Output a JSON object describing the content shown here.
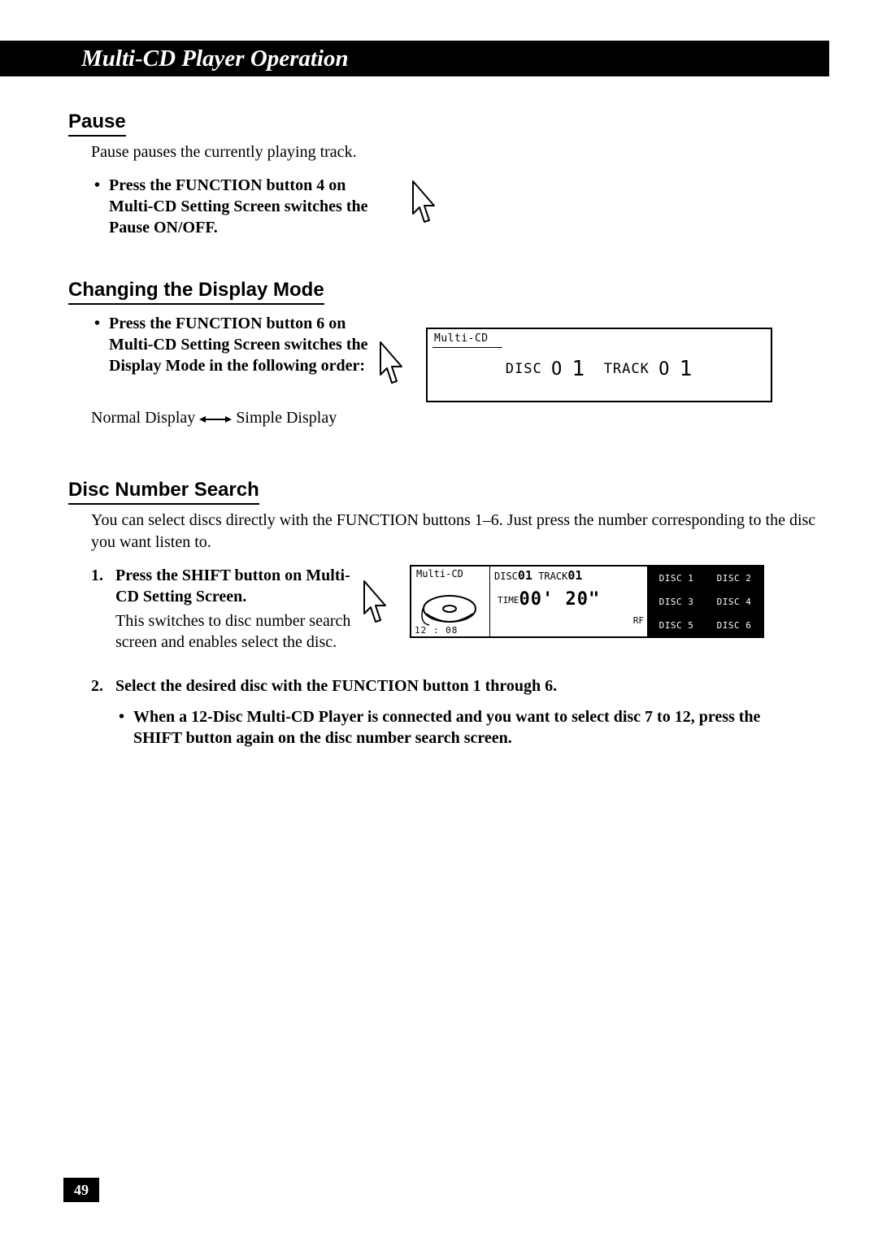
{
  "title": "Multi-CD Player Operation",
  "pageNumber": "49",
  "pause": {
    "heading": "Pause",
    "intro": "Pause pauses the currently playing track.",
    "bullet": "Press the FUNCTION button 4 on Multi-CD Setting Screen switches the Pause ON/OFF."
  },
  "displayMode": {
    "heading": "Changing the Display Mode",
    "bullet": "Press the FUNCTION button 6 on Multi-CD Setting Screen switches the Display Mode in the following order:",
    "flowLeft": "Normal Display",
    "flowRight": "Simple Display",
    "lcd": {
      "title": "Multi-CD",
      "discLabel": "DISC",
      "discVal": "O 1",
      "trackLabel": "TRACK",
      "trackVal": "O 1"
    }
  },
  "discSearch": {
    "heading": "Disc Number Search",
    "intro": "You can select discs directly with the FUNCTION buttons 1–6. Just press the number corresponding to the disc you want listen to.",
    "step1Num": "1.",
    "step1": "Press the SHIFT button on Multi-CD Setting Screen.",
    "step1Sub": "This switches to disc number search screen and enables select the disc.",
    "step2Num": "2.",
    "step2": "Select the desired disc with the FUNCTION button 1 through 6.",
    "step2Bullet": "When a 12-Disc Multi-CD Player is connected and you want to select disc 7 to 12, press the SHIFT button again on the disc number search screen.",
    "lcd": {
      "title": "Multi-CD",
      "discLabel": "DISC",
      "discVal": "01",
      "trackLabel": "TRACK",
      "trackVal": "01",
      "timeLabel": "TIME",
      "timeVal": "00' 20\"",
      "rf": "RF",
      "clock": "12 : 08",
      "discs": [
        "DISC 1",
        "DISC 2",
        "DISC 3",
        "DISC 4",
        "DISC 5",
        "DISC 6"
      ]
    }
  }
}
